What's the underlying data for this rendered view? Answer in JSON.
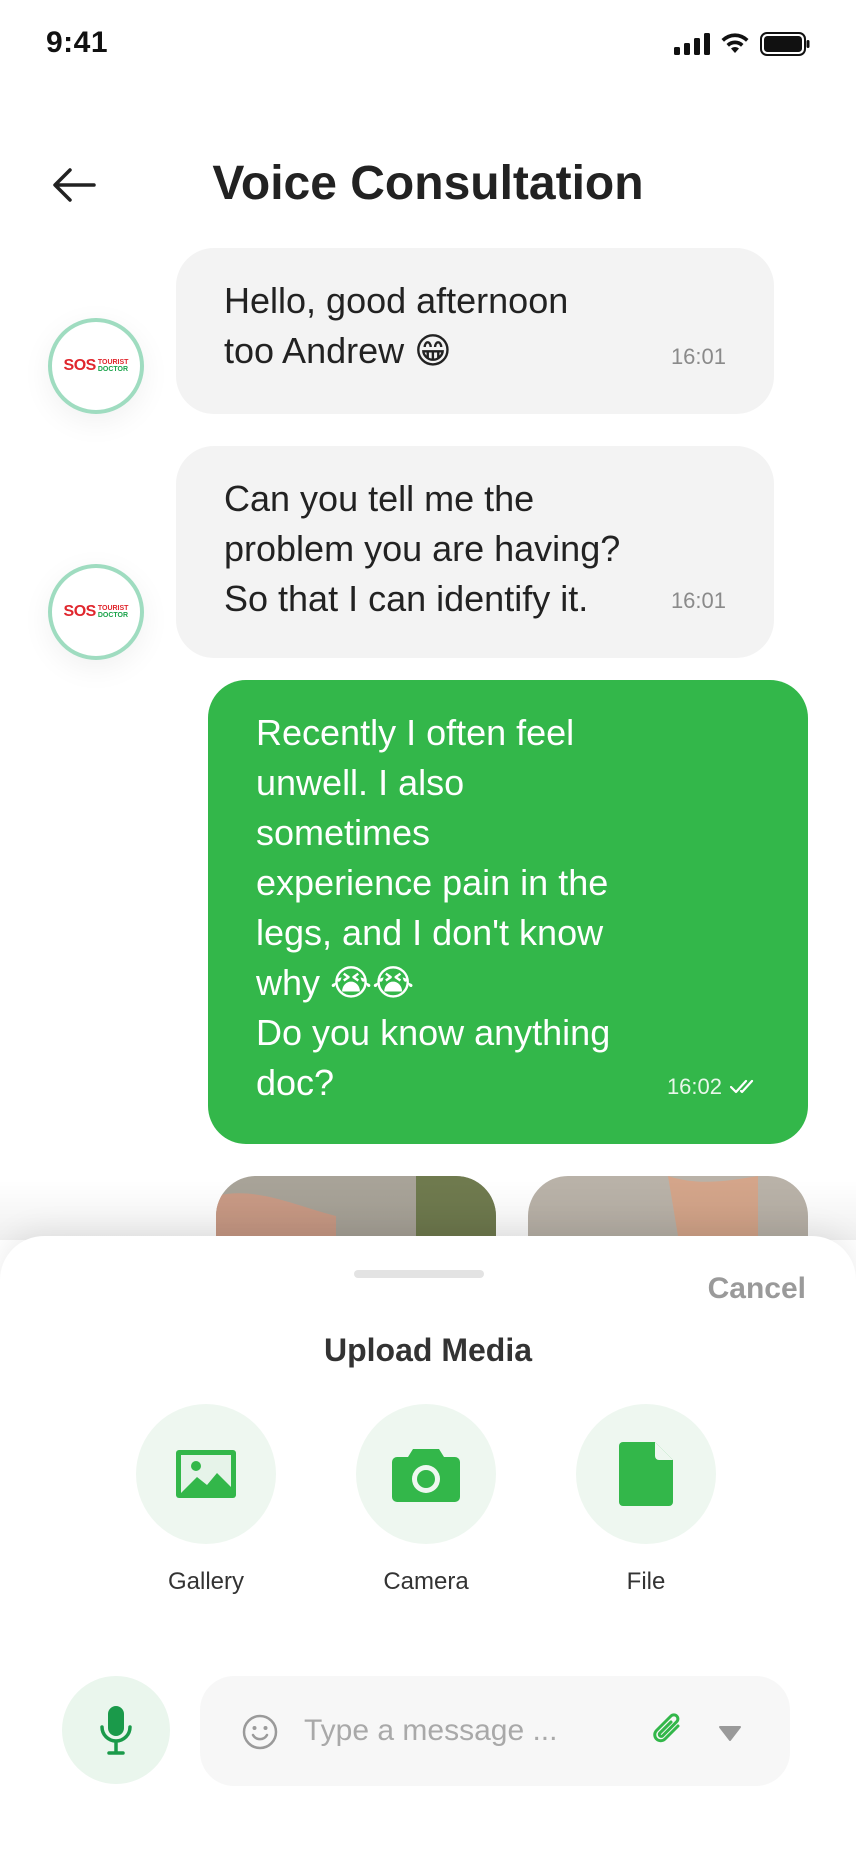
{
  "status_bar": {
    "time": "9:41"
  },
  "header": {
    "title": "Voice Consultation"
  },
  "avatar": {
    "sos": "SOS",
    "line1": "TOURIST",
    "line2": "DOCTOR"
  },
  "messages": [
    {
      "direction": "incoming",
      "text": "Hello, good afternoon\ntoo Andrew 😁",
      "time": "16:01"
    },
    {
      "direction": "incoming",
      "text": "Can you tell me the\nproblem you are having?\nSo that I can identify it.",
      "time": "16:01"
    },
    {
      "direction": "outgoing",
      "text": "Recently I often feel\nunwell. I also\nsometimes\nexperience pain in the\nlegs, and I don't know\nwhy 😭😭\nDo you know anything\ndoc?",
      "time": "16:02",
      "status": "read"
    }
  ],
  "upload_sheet": {
    "cancel_label": "Cancel",
    "title": "Upload Media",
    "options": [
      {
        "label": "Gallery",
        "icon": "image-icon"
      },
      {
        "label": "Camera",
        "icon": "camera-icon"
      },
      {
        "label": "File",
        "icon": "file-icon"
      }
    ]
  },
  "composer": {
    "placeholder": "Type a message ...",
    "value": ""
  },
  "colors": {
    "accent": "#33b74a",
    "incoming_bubble": "#f3f3f3",
    "avatar_ring": "#9fdcc0"
  }
}
